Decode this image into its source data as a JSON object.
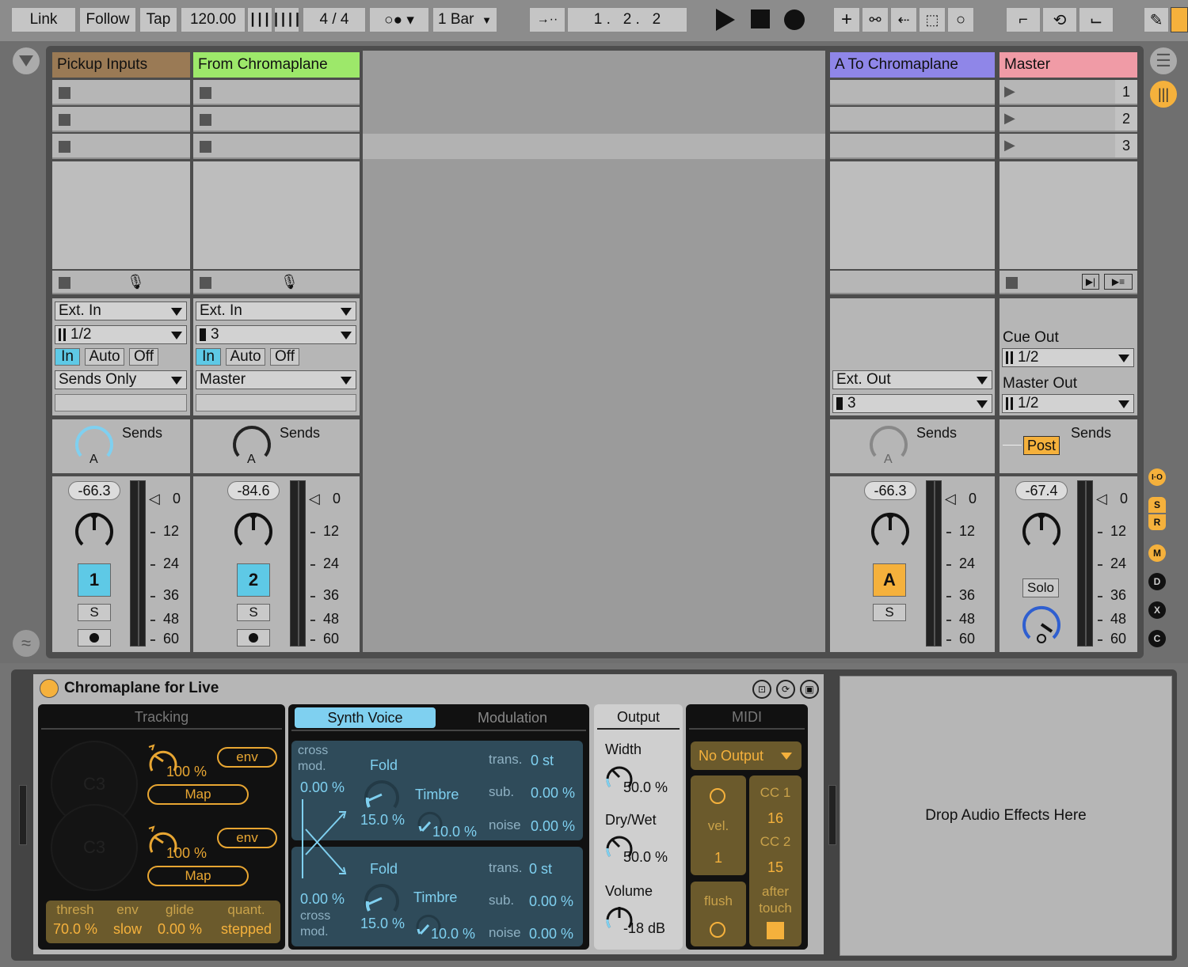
{
  "transport": {
    "link": "Link",
    "follow": "Follow",
    "tap": "Tap",
    "tempo": "120.00",
    "meter": "4 / 4",
    "quantize": "1 Bar",
    "position": "1 .   2 .   2"
  },
  "tracks": [
    {
      "name": "Pickup Inputs",
      "color": "#9a7a55",
      "input_type": "Ext. In",
      "input_channel": "1/2",
      "monitor": [
        "In",
        "Auto",
        "Off"
      ],
      "output": "Sends Only",
      "sends_label": "Sends",
      "send_name": "A",
      "volume": "-66.3",
      "number": "1",
      "solo": "S"
    },
    {
      "name": "From Chromaplane",
      "color": "#9de86a",
      "input_type": "Ext. In",
      "input_channel": "3",
      "monitor": [
        "In",
        "Auto",
        "Off"
      ],
      "output": "Master",
      "sends_label": "Sends",
      "send_name": "A",
      "volume": "-84.6",
      "number": "2",
      "solo": "S"
    }
  ],
  "return_track": {
    "name": "A To Chromaplane",
    "color": "#8f86e8",
    "output": "Ext. Out",
    "output_channel": "3",
    "sends_label": "Sends",
    "send_name": "A",
    "volume": "-66.3",
    "letter": "A",
    "solo": "S"
  },
  "master": {
    "name": "Master",
    "color": "#f09ba6",
    "scenes": [
      "1",
      "2",
      "3"
    ],
    "cue_out_label": "Cue Out",
    "cue_out": "1/2",
    "master_out_label": "Master Out",
    "master_out": "1/2",
    "post": "Post",
    "sends_label": "Sends",
    "volume": "-67.4",
    "solo": "Solo"
  },
  "meter_ticks": [
    "0",
    "12",
    "24",
    "36",
    "48",
    "60"
  ],
  "side_buttons": [
    "I·O",
    "S",
    "R",
    "M",
    "D",
    "X",
    "C"
  ],
  "device": {
    "title": "Chromaplane for Live",
    "tracking": {
      "header": "Tracking",
      "note1": "C3",
      "note2": "C3",
      "knob1": "100 %",
      "knob2": "100 %",
      "env": "env",
      "map": "Map",
      "params": [
        {
          "label": "thresh",
          "value": "70.0 %"
        },
        {
          "label": "env",
          "value": "slow"
        },
        {
          "label": "glide",
          "value": "0.00 %"
        },
        {
          "label": "quant.",
          "value": "stepped"
        }
      ]
    },
    "synth": {
      "tab_active": "Synth Voice",
      "tab_other": "Modulation",
      "voice1": {
        "cross": "cross\nmod.",
        "cross_val": "0.00 %",
        "fold": "Fold",
        "fold_val": "15.0 %",
        "timbre": "Timbre",
        "timbre_val": "10.0 %",
        "trans": "trans.",
        "trans_val": "0 st",
        "sub": "sub.",
        "sub_val": "0.00 %",
        "noise": "noise",
        "noise_val": "0.00 %"
      },
      "voice2": {
        "cross": "cross\nmod.",
        "cross_val": "0.00 %",
        "fold": "Fold",
        "fold_val": "15.0 %",
        "timbre": "Timbre",
        "timbre_val": "10.0 %",
        "trans": "trans.",
        "trans_val": "0 st",
        "sub": "sub.",
        "sub_val": "0.00 %",
        "noise": "noise",
        "noise_val": "0.00 %"
      }
    },
    "output": {
      "header": "Output",
      "width": "Width",
      "width_val": "50.0 %",
      "drywet": "Dry/Wet",
      "drywet_val": "50.0 %",
      "volume": "Volume",
      "volume_val": "-18 dB"
    },
    "midi": {
      "header": "MIDI",
      "output": "No Output",
      "vel": "vel.",
      "vel_val": "1",
      "cc1": "CC 1",
      "cc1_val": "16",
      "cc2": "CC 2",
      "cc2_val": "15",
      "after": "after\ntouch",
      "flush": "flush"
    }
  },
  "drop_hint": "Drop Audio Effects Here"
}
